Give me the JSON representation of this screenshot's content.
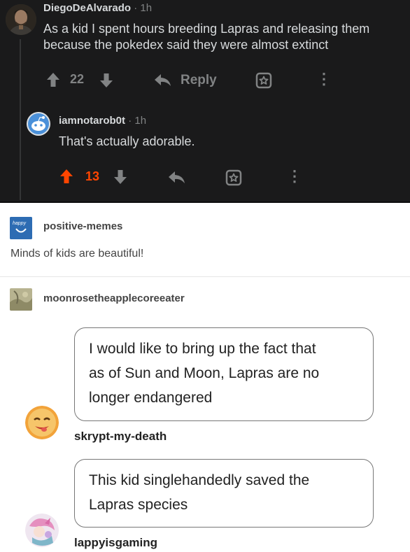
{
  "reddit": {
    "comment1": {
      "username": "DiegoDeAlvarado",
      "separator": "·",
      "time": "1h",
      "body": "As a kid I spent hours breeding Lapras and releasing them because the pokedex said they were almost extinct",
      "score": "22",
      "reply_label": "Reply",
      "more_icon": "⋮"
    },
    "comment2": {
      "username": "iamnotarob0t",
      "separator": "·",
      "time": "1h",
      "body": "That's actually adorable.",
      "score": "13",
      "more_icon": "⋮"
    },
    "colors": {
      "upvote_active": "#ff4500",
      "text": "#d7dadc",
      "muted": "#818384",
      "background": "#1a1a1b"
    }
  },
  "tumblr": {
    "post1": {
      "username": "positive-memes",
      "avatar_text": "happy",
      "text": "Minds of kids are beautiful!"
    },
    "post2": {
      "username": "moonrosetheapplecoreeater"
    },
    "chat": [
      {
        "text_lines": [
          "I would like to bring up the fact that",
          "as of Sun and Moon, Lapras are no",
          "longer endangered"
        ],
        "username": "skrypt-my-death"
      },
      {
        "text_lines": [
          "This kid singlehandedly saved the",
          "Lapras species"
        ],
        "username": "lappyisgaming"
      }
    ]
  }
}
